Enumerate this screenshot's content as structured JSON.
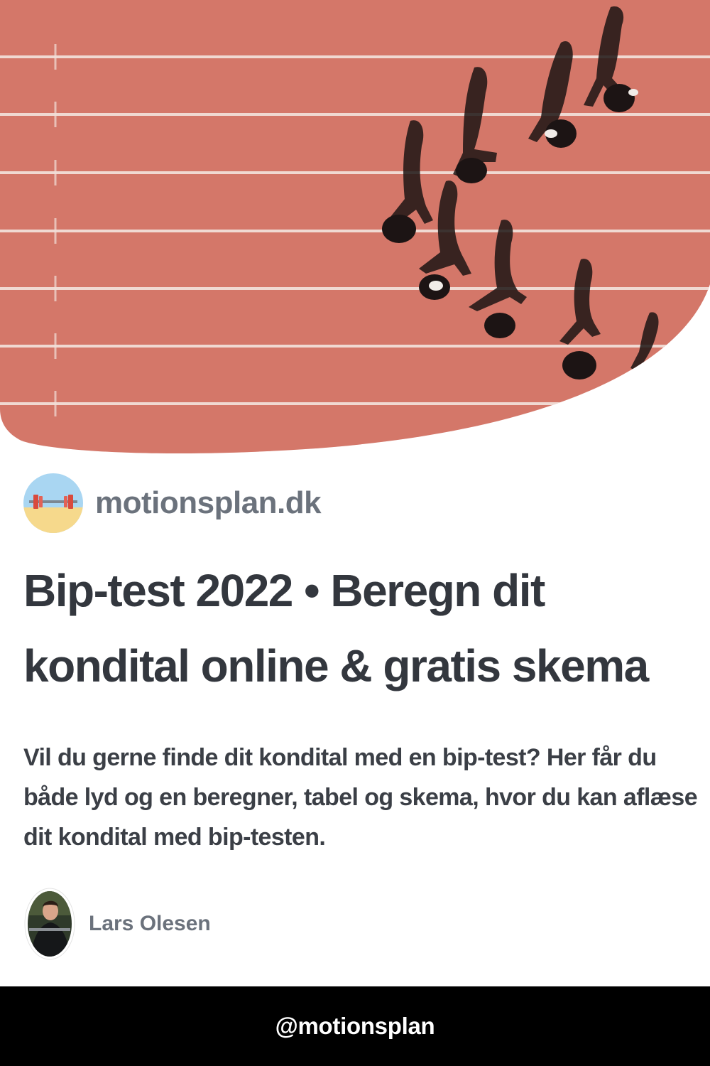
{
  "hero": {
    "image": "aerial-running-track-runners-photo"
  },
  "site": {
    "name": "motionsplan.dk",
    "logo_icon": "barbell-on-beach-icon"
  },
  "article": {
    "title": "Bip-test 2022 • Beregn dit kondital online & gratis skema",
    "description": "Vil du gerne finde dit kondital med en bip-test? Her får du både lyd og en beregner, tabel og skema, hvor du kan aflæse dit kondital med bip-testen."
  },
  "author": {
    "name": "Lars Olesen",
    "avatar_icon": "author-photo-avatar"
  },
  "footer": {
    "handle": "@motionsplan"
  },
  "colors": {
    "track": "#d97a6c",
    "track_line": "#f4e2dc",
    "site_name": "#6b727c",
    "title": "#33373e",
    "footer_bg": "#000000",
    "footer_text": "#ffffff"
  }
}
